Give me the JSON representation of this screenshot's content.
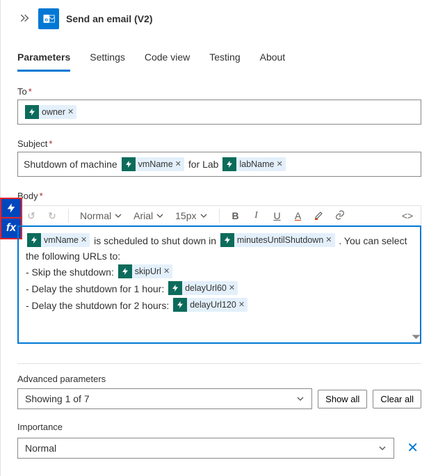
{
  "header": {
    "title": "Send an email (V2)"
  },
  "tabs": [
    "Parameters",
    "Settings",
    "Code view",
    "Testing",
    "About"
  ],
  "active_tab": 0,
  "fields": {
    "to": {
      "label": "To",
      "pills": [
        "owner"
      ]
    },
    "subject": {
      "label": "Subject",
      "parts": [
        {
          "t": "text",
          "v": "Shutdown of machine "
        },
        {
          "t": "pill",
          "v": "vmName"
        },
        {
          "t": "text",
          "v": " for Lab "
        },
        {
          "t": "pill",
          "v": "labName"
        }
      ]
    },
    "body": {
      "label": "Body",
      "lines": [
        [
          {
            "t": "pill",
            "v": "vmName"
          },
          {
            "t": "text",
            "v": " is scheduled to shut down in "
          },
          {
            "t": "pill",
            "v": "minutesUntilShutdown"
          },
          {
            "t": "text",
            "v": " . You can select the following URLs to:"
          }
        ],
        [
          {
            "t": "text",
            "v": " - Skip the shutdown: "
          },
          {
            "t": "pill",
            "v": "skipUrl"
          }
        ],
        [
          {
            "t": "text",
            "v": " - Delay the shutdown for 1 hour: "
          },
          {
            "t": "pill",
            "v": "delayUrl60"
          }
        ],
        [
          {
            "t": "text",
            "v": " - Delay the shutdown for 2 hours: "
          },
          {
            "t": "pill",
            "v": "delayUrl120"
          }
        ]
      ]
    }
  },
  "toolbar": {
    "font_style": "Normal",
    "font_family": "Arial",
    "font_size": "15px"
  },
  "advanced": {
    "label": "Advanced parameters",
    "showing": "Showing 1 of 7",
    "show_all": "Show all",
    "clear_all": "Clear all"
  },
  "importance": {
    "label": "Importance",
    "value": "Normal"
  }
}
